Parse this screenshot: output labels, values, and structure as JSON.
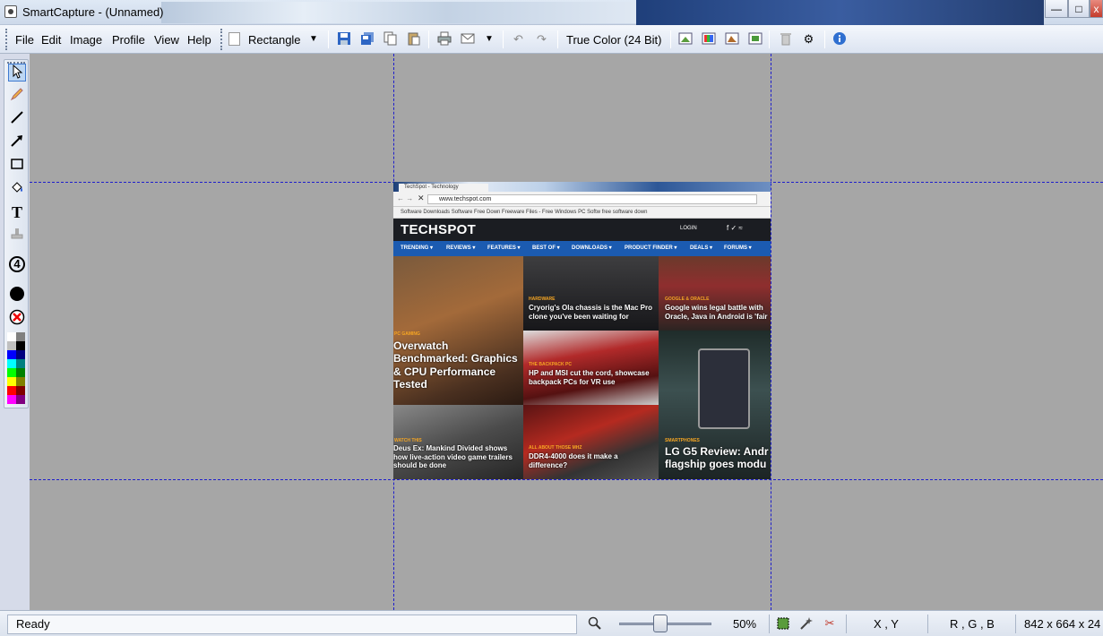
{
  "window": {
    "title": "SmartCapture - (Unnamed)",
    "min": "—",
    "max": "□",
    "close": "x"
  },
  "menu": [
    "File",
    "Edit",
    "Image",
    "Profile",
    "View",
    "Help"
  ],
  "toolbar": {
    "selection_tool": "Rectangle",
    "color_mode": "True Color (24 Bit)",
    "icons": [
      "new-icon",
      "save-icon",
      "save-as-icon",
      "copy-icon",
      "paste-icon",
      "print-icon",
      "email-icon",
      "undo-icon",
      "redo-icon",
      "resize-icon",
      "color-balance-icon",
      "brightness-icon",
      "crop-icon",
      "delete-icon",
      "settings-icon",
      "info-icon"
    ]
  },
  "tools": {
    "step_number": "4",
    "items": [
      "select-tool",
      "pencil-tool",
      "line-tool",
      "arrow-tool",
      "rectangle-tool",
      "fill-tool",
      "text-tool",
      "stamp-tool",
      "step-tool",
      "color-fill",
      "no-color"
    ]
  },
  "palette": [
    "#ffffff",
    "#808080",
    "#c0c0c0",
    "#000000",
    "#0000ff",
    "#000080",
    "#00ffff",
    "#008080",
    "#00ff00",
    "#008000",
    "#ffff00",
    "#808000",
    "#ff0000",
    "#800000",
    "#ff00ff",
    "#800080"
  ],
  "screenshot": {
    "tab": "TechSpot - Technology",
    "url": "www.techspot.com",
    "bookmarks": "Software Downloads   Software Free Down   Freeware Files - Free   Windows PC Softw   free software down",
    "logo": "TECHSPOT",
    "login": "LOGIN",
    "social": "f ✓ ≈",
    "nav": [
      "TRENDING ▾",
      "REVIEWS ▾",
      "FEATURES ▾",
      "BEST OF ▾",
      "DOWNLOADS ▾",
      "PRODUCT FINDER ▾",
      "DEALS ▾",
      "FORUMS ▾"
    ],
    "articles": [
      {
        "cat": "PC GAMING",
        "title": "Overwatch Benchmarked: Graphics & CPU Performance Tested"
      },
      {
        "cat": "HARDWARE",
        "title": "Cryorig's Ola chassis is the Mac Pro clone you've been waiting for"
      },
      {
        "cat": "GOOGLE & ORACLE",
        "title": "Google wins legal battle with Oracle, Java in Android is 'fair"
      },
      {
        "cat": "THE BACKPACK PC",
        "title": "HP and MSI cut the cord, showcase backpack PCs for VR use"
      },
      {
        "cat": "SMARTPHONES",
        "title": "LG G5 Review: Andr flagship goes modu"
      },
      {
        "cat": "WATCH THIS",
        "title": "Deus Ex: Mankind Divided shows how live-action video game trailers should be done"
      },
      {
        "cat": "ALL ABOUT THOSE MHZ",
        "title": "DDR4-4000 does it make a difference?"
      }
    ]
  },
  "status": {
    "ready": "Ready",
    "zoom": "50%",
    "zoom_level": 0.5,
    "coords": "X , Y",
    "rgb": "R , G , B",
    "size": "842 x 664 x 24"
  }
}
